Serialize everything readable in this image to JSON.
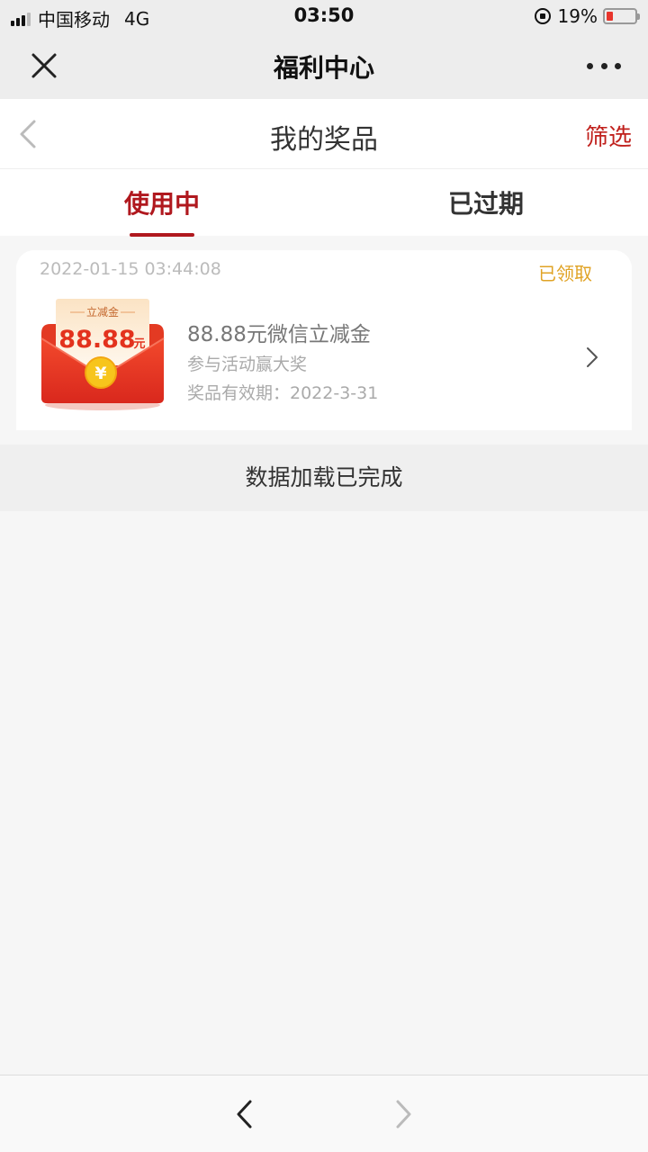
{
  "status_bar": {
    "carrier": "中国移动",
    "network": "4G",
    "time": "03:50",
    "battery": "19%",
    "battery_color": "#e8352c"
  },
  "wechat_header": {
    "title": "福利中心",
    "close_icon": "close-icon",
    "more_icon": "more-icon"
  },
  "page_nav": {
    "title": "我的奖品",
    "filter_label": "筛选",
    "back_icon": "chevron-left-icon"
  },
  "tabs": [
    {
      "label": "使用中",
      "active": true
    },
    {
      "label": "已过期",
      "active": false
    }
  ],
  "prize_card": {
    "datetime": "2022-01-15 03:44:08",
    "status": "已领取",
    "envelope_tag": "立减金",
    "envelope_amount": "88.88",
    "envelope_unit": "元",
    "envelope_coin": "¥",
    "name": "88.88元微信立减金",
    "description": "参与活动赢大奖",
    "expiry": "奖品有效期：2022-3-31"
  },
  "load_status": "数据加载已完成",
  "colors": {
    "accent_red": "#b0181e",
    "status_gold": "#e0a325"
  }
}
